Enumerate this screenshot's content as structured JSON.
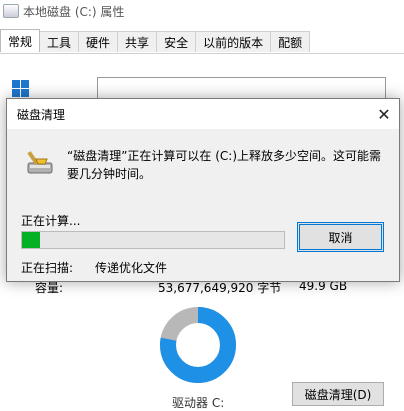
{
  "properties": {
    "title": "本地磁盘 (C:) 属性",
    "tabs": [
      "常规",
      "工具",
      "硬件",
      "共享",
      "安全",
      "以前的版本",
      "配额"
    ],
    "active_tab": 0,
    "capacity_label": "容量:",
    "capacity_bytes": "53,677,649,920 字节",
    "capacity_gb": "49.9 GB",
    "drive_label": "驱动器 C:",
    "cleanup_button": "磁盘清理(D)",
    "used_fraction": 0.78,
    "used_color": "#1e90e6",
    "free_color": "#b8b8b8"
  },
  "dialog": {
    "title": "磁盘清理",
    "close_icon": "close-icon",
    "message": "“磁盘清理”正在计算可以在 (C:)上释放多少空间。这可能需要几分钟时间。",
    "calculating_label": "正在计算...",
    "progress_fraction": 0.07,
    "progress_color": "#06b025",
    "cancel_button": "取消",
    "scanning_label": "正在扫描:",
    "scanning_value": "传递优化文件"
  }
}
